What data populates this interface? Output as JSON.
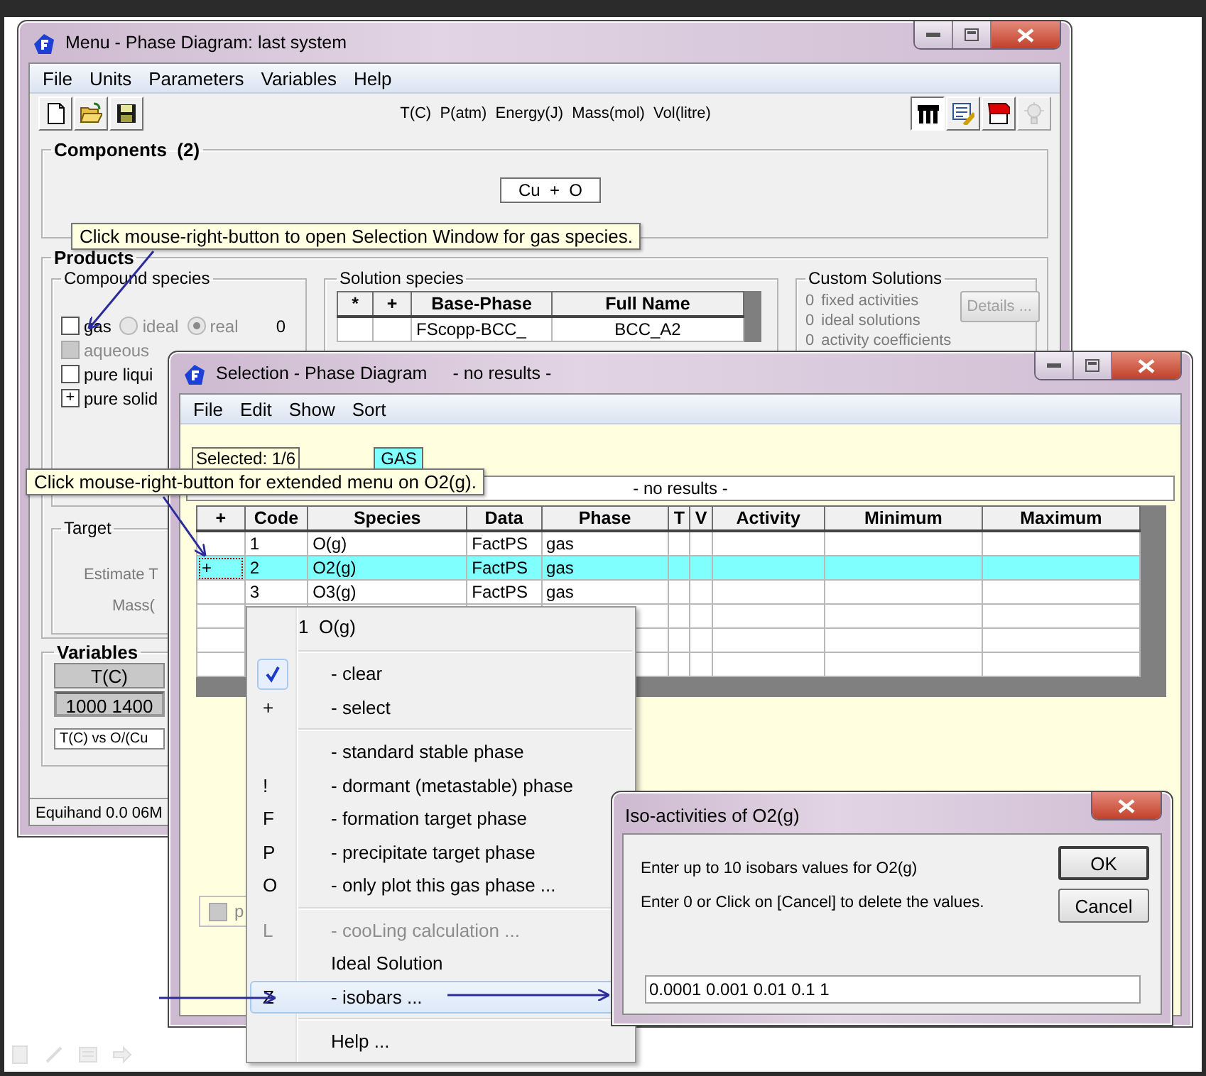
{
  "main_window": {
    "title": "Menu - Phase Diagram: last system",
    "menu": [
      "File",
      "Units",
      "Parameters",
      "Variables",
      "Help"
    ],
    "units": "T(C)  P(atm)  Energy(J)  Mass(mol)  Vol(litre)",
    "tools": [
      {
        "kind": "utensils",
        "pressed": true,
        "disabled": false
      },
      {
        "kind": "sheet",
        "pressed": false,
        "disabled": false
      },
      {
        "kind": "book",
        "pressed": false,
        "disabled": false
      },
      {
        "kind": "bulb",
        "pressed": false,
        "disabled": true
      }
    ],
    "components": {
      "title": "Components  (2)",
      "formula": "Cu  +  O"
    },
    "products": {
      "title": "Products",
      "compound_species": {
        "title": "Compound species",
        "items": [
          {
            "label": "gas",
            "checked": false,
            "disabled": false,
            "count": "0",
            "options": [
              {
                "label": "ideal",
                "selected": false,
                "disabled": true
              },
              {
                "label": "real",
                "selected": true,
                "disabled": true
              }
            ]
          },
          {
            "label": "aqueous",
            "checked": false,
            "disabled": true
          },
          {
            "label": "pure liqui",
            "checked": false,
            "disabled": false
          },
          {
            "label": "pure solid",
            "checked": true,
            "disabled": false,
            "mark": "+"
          }
        ]
      },
      "solution_species": {
        "title": "Solution species",
        "columns": [
          "*",
          "+",
          "Base-Phase",
          "Full Name"
        ],
        "rows": [
          {
            "base_phase": "FScopp-BCC_",
            "full_name": "BCC_A2",
            "highlighted": false
          }
        ]
      },
      "custom_solutions": {
        "title": "Custom Solutions",
        "lines": [
          {
            "count": "0",
            "label": "fixed activities"
          },
          {
            "count": "0",
            "label": "ideal solutions"
          },
          {
            "count": "0",
            "label": "activity coefficients"
          }
        ],
        "button": {
          "label": "Details ...",
          "disabled": true
        }
      },
      "target": {
        "title": "Target",
        "labels": [
          "Estimate T",
          "Mass("
        ]
      }
    },
    "variables": {
      "title": "Variables",
      "column": "T(C)",
      "value": "1000 1400",
      "plot": "T(C) vs O/(Cu"
    },
    "status": "Equihand 0.0 06M"
  },
  "selection_window": {
    "title": "Selection - Phase Diagram",
    "subtitle": "- no results -",
    "menu": [
      "File",
      "Edit",
      "Show",
      "Sort"
    ],
    "selected_count": "Selected: 1/6",
    "phase": "GAS",
    "results": "- no results -",
    "table": {
      "columns": [
        "+",
        "Code",
        "Species",
        "Data",
        "Phase",
        "T",
        "V",
        "Activity",
        "Minimum",
        "Maximum"
      ],
      "rows": [
        {
          "code": "1",
          "species": "O(g)",
          "data": "FactPS",
          "phase": "gas",
          "selected": false
        },
        {
          "mark": "+",
          "code": "2",
          "species": "O2(g)",
          "data": "FactPS",
          "phase": "gas",
          "selected": true
        },
        {
          "code": "3",
          "species": "O3(g)",
          "data": "FactPS",
          "phase": "gas",
          "selected": false
        },
        {
          "selected": false
        },
        {
          "selected": false
        },
        {
          "selected": false
        }
      ]
    },
    "option": {
      "label": "p",
      "checked": false
    }
  },
  "context_menu": [
    {
      "kind": "header",
      "label": "1  O(g)"
    },
    {
      "kind": "separator"
    },
    {
      "kind": "item",
      "label": "- clear",
      "checked": true,
      "disabled": false,
      "selected": false
    },
    {
      "kind": "item",
      "key": "+",
      "label": "- select",
      "checked": false,
      "disabled": false,
      "selected": false
    },
    {
      "kind": "separator"
    },
    {
      "kind": "item",
      "label": "- standard stable phase",
      "checked": false,
      "disabled": false,
      "selected": false
    },
    {
      "kind": "item",
      "key": "!",
      "label": "- dormant (metastable) phase",
      "checked": false,
      "disabled": false,
      "selected": false
    },
    {
      "kind": "item",
      "key": "F",
      "label": "- formation target phase",
      "checked": false,
      "disabled": false,
      "selected": false
    },
    {
      "kind": "item",
      "key": "P",
      "label": "- precipitate target phase",
      "checked": false,
      "disabled": false,
      "selected": false
    },
    {
      "kind": "item",
      "key": "O",
      "label": "- only plot this gas phase ...",
      "checked": false,
      "disabled": false,
      "selected": false
    },
    {
      "kind": "separator"
    },
    {
      "kind": "item",
      "key": "L",
      "label": "- cooLing calculation ...",
      "checked": false,
      "disabled": true,
      "selected": false
    },
    {
      "kind": "item",
      "label": "Ideal Solution",
      "checked": false,
      "disabled": false,
      "selected": false
    },
    {
      "kind": "item",
      "key": "Z",
      "label": "- isobars ...",
      "checked": false,
      "disabled": false,
      "selected": true
    },
    {
      "kind": "separator"
    },
    {
      "kind": "item",
      "label": "Help ...",
      "checked": false,
      "disabled": false,
      "selected": false
    }
  ],
  "dialog": {
    "title": "Iso-activities of O2(g)",
    "lines": [
      "Enter up to 10 isobars values for O2(g)",
      "Enter 0 or Click on [Cancel] to delete the values."
    ],
    "buttons": [
      "OK",
      "Cancel"
    ],
    "value": "0.0001 0.001 0.01 0.1 1"
  },
  "tooltips": [
    {
      "text": "Click mouse-right-button to open Selection Window for gas species."
    },
    {
      "text": "Click mouse-right-button for extended menu on O2(g)."
    }
  ]
}
